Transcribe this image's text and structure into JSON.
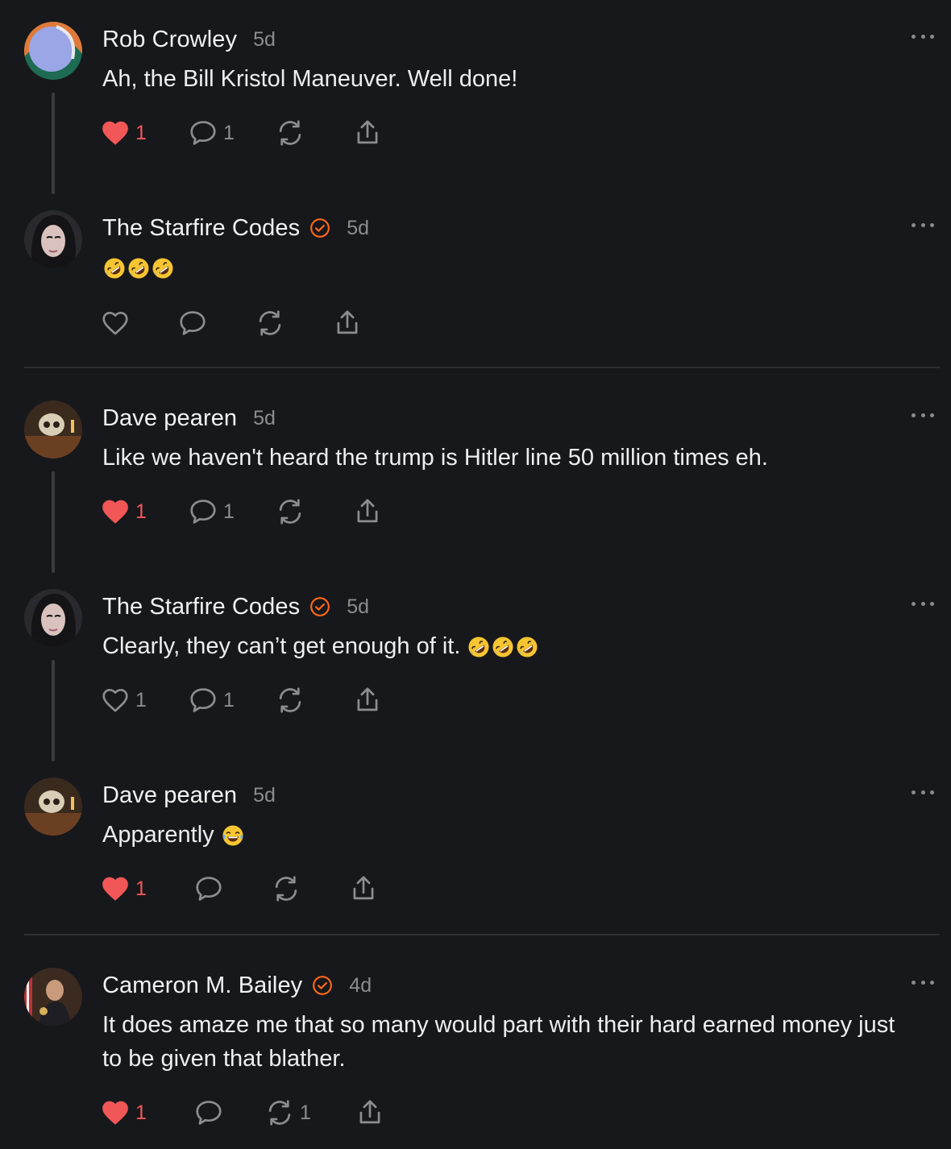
{
  "icons": {
    "verified": "verified-badge-icon",
    "more": "more-options-icon",
    "like": "heart-icon",
    "reply": "comment-bubble-icon",
    "restack": "restack-icon",
    "share": "share-icon",
    "emoji_rofl": "rolling-on-floor-laughing-emoji",
    "emoji_joy": "tears-of-joy-emoji"
  },
  "colors": {
    "background": "#17181b",
    "liked_heart": "#f25757",
    "verified_badge": "#ff6719",
    "muted_text": "#8c8d92",
    "divider": "#2e2f33"
  },
  "comments": [
    {
      "author": "Rob Crowley",
      "time": "5d",
      "text": "Ah, the Bill Kristol Maneuver. Well done!",
      "likes": "1",
      "replies": "1",
      "restacks": ""
    },
    {
      "author": "The Starfire Codes",
      "time": "5d",
      "text": "",
      "likes": "",
      "replies": "",
      "restacks": ""
    },
    {
      "author": "Dave pearen",
      "time": "5d",
      "text": "Like we haven't heard the trump is Hitler line 50 million times eh.",
      "likes": "1",
      "replies": "1",
      "restacks": ""
    },
    {
      "author": "The Starfire Codes",
      "time": "5d",
      "text": "Clearly, they can’t get enough of it.",
      "likes": "1",
      "replies": "1",
      "restacks": ""
    },
    {
      "author": "Dave pearen",
      "time": "5d",
      "text": "Apparently",
      "likes": "1",
      "replies": "",
      "restacks": ""
    },
    {
      "author": "Cameron M. Bailey",
      "time": "4d",
      "text": "It does amaze me that so many would part with their hard earned money just to be given that blather.",
      "likes": "1",
      "replies": "",
      "restacks": "1"
    }
  ]
}
